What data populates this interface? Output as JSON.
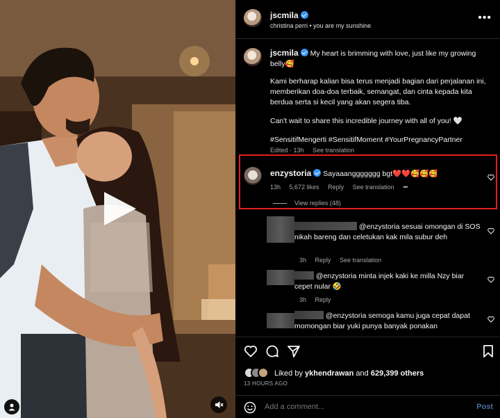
{
  "post": {
    "username": "jscmila",
    "audio": "christina perri • you are my sunshine"
  },
  "caption": {
    "username": "jscmila",
    "line1": "My heart is brimming with love, just like my growing belly🥰",
    "para2": "Kami berharap kalian bisa terus menjadi bagian dari perjalanan ini, memberikan doa-doa terbaik, semangat, dan cinta kepada kita berdua serta si kecil yang akan segera tiba.",
    "para3": "Can't wait to share this incredible journey with all of you! 🤍",
    "hashtags": "#SensitifMengerti #SensitifMoment #YourPregnancyPartner",
    "edited": "Edited · 13h",
    "see_translation": "See translation"
  },
  "highlighted_comment": {
    "username": "enzystoria",
    "text": "Sayaaanggggggg bgt❤️❤️🥰🥰🥰",
    "time": "13h",
    "likes": "5,672 likes",
    "reply": "Reply",
    "see_translation": "See translation",
    "more": "•••",
    "view_replies": "View replies (48)"
  },
  "replies": [
    {
      "mention": "@enzystoria",
      "text": "sesuai omongan di SOS nikah bareng dan celetukan kak mila subur deh",
      "time": "3h",
      "reply": "Reply",
      "see_translation": "See translation"
    },
    {
      "mention": "@enzystoria",
      "text": "minta injek kaki ke milla Nzy biar cepet nular 🤣",
      "time": "3h",
      "reply": "Reply"
    },
    {
      "mention": "@enzystoria",
      "text": "semoga kamu juga cepat dapat momongan biar yuki punya banyak ponakan"
    }
  ],
  "actions": {
    "liked_by_prefix": "Liked by",
    "liked_by_user": "ykhendrawan",
    "liked_by_and": "and",
    "liked_by_count": "629,399 others",
    "time_ago": "13 HOURS AGO",
    "add_comment_placeholder": "Add a comment...",
    "post_label": "Post"
  },
  "colors": {
    "highlight_border": "#e02020",
    "verified": "#3897f0",
    "post_button": "#4a6e9e"
  },
  "icons": [
    "play-icon",
    "user-tag-icon",
    "mute-icon",
    "more-icon",
    "heart-icon",
    "comment-icon",
    "share-icon",
    "bookmark-icon",
    "emoji-icon"
  ]
}
